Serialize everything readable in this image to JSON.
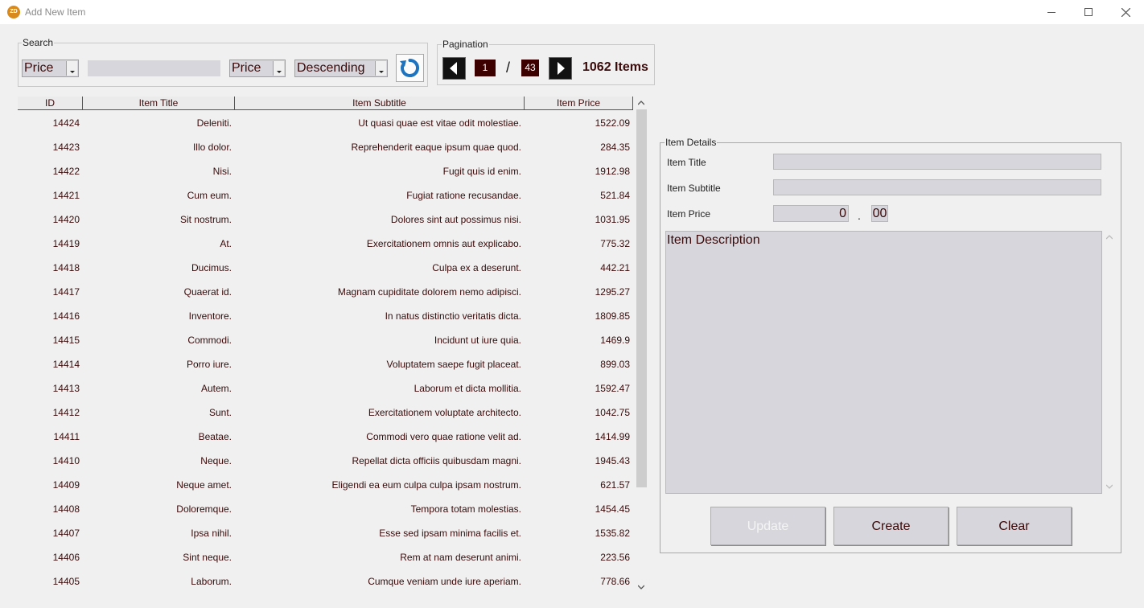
{
  "window": {
    "title": "Add New Item",
    "icon_text": "ZD"
  },
  "search": {
    "legend": "Search",
    "field_select": "Price",
    "query": "",
    "sort_by": "Price",
    "order": "Descending"
  },
  "pagination": {
    "legend": "Pagination",
    "current_page": "1",
    "separator": "/",
    "total_pages": "43",
    "items_count": "1062 Items"
  },
  "table": {
    "columns": [
      "ID",
      "Item Title",
      "Item Subtitle",
      "Item Price"
    ],
    "rows": [
      [
        "14424",
        "Deleniti.",
        "Ut quasi quae est vitae odit molestiae.",
        "1522.09"
      ],
      [
        "14423",
        "Illo dolor.",
        "Reprehenderit eaque ipsum quae quod.",
        "284.35"
      ],
      [
        "14422",
        "Nisi.",
        "Fugit quis id enim.",
        "1912.98"
      ],
      [
        "14421",
        "Cum eum.",
        "Fugiat ratione recusandae.",
        "521.84"
      ],
      [
        "14420",
        "Sit nostrum.",
        "Dolores sint aut possimus nisi.",
        "1031.95"
      ],
      [
        "14419",
        "At.",
        "Exercitationem omnis aut explicabo.",
        "775.32"
      ],
      [
        "14418",
        "Ducimus.",
        "Culpa ex a deserunt.",
        "442.21"
      ],
      [
        "14417",
        "Quaerat id.",
        "Magnam cupiditate dolorem nemo adipisci.",
        "1295.27"
      ],
      [
        "14416",
        "Inventore.",
        "In natus distinctio veritatis dicta.",
        "1809.85"
      ],
      [
        "14415",
        "Commodi.",
        "Incidunt ut iure quia.",
        "1469.9"
      ],
      [
        "14414",
        "Porro iure.",
        "Voluptatem saepe fugit placeat.",
        "899.03"
      ],
      [
        "14413",
        "Autem.",
        "Laborum et dicta mollitia.",
        "1592.47"
      ],
      [
        "14412",
        "Sunt.",
        "Exercitationem voluptate architecto.",
        "1042.75"
      ],
      [
        "14411",
        "Beatae.",
        "Commodi vero quae ratione velit ad.",
        "1414.99"
      ],
      [
        "14410",
        "Neque.",
        "Repellat dicta officiis quibusdam magni.",
        "1945.43"
      ],
      [
        "14409",
        "Neque amet.",
        "Eligendi ea eum culpa culpa ipsam nostrum.",
        "621.57"
      ],
      [
        "14408",
        "Doloremque.",
        "Tempora totam molestias.",
        "1454.45"
      ],
      [
        "14407",
        "Ipsa nihil.",
        "Esse sed ipsam minima facilis et.",
        "1535.82"
      ],
      [
        "14406",
        "Sint neque.",
        "Rem at nam deserunt animi.",
        "223.56"
      ],
      [
        "14405",
        "Laborum.",
        "Cumque veniam unde iure aperiam.",
        "778.66"
      ]
    ]
  },
  "details": {
    "legend": "Item Details",
    "title_label": "Item Title",
    "title_value": "",
    "subtitle_label": "Item Subtitle",
    "subtitle_value": "",
    "price_label": "Item Price",
    "price_int": "0",
    "price_sep": ".",
    "price_dec": "00",
    "description_placeholder": "Item Description"
  },
  "buttons": {
    "update": "Update",
    "create": "Create",
    "clear": "Clear"
  },
  "colors": {
    "accent_text": "#3a0a0a",
    "page_box": "#3d0000",
    "refresh_icon": "#1e73be"
  },
  "icons": {
    "refresh": "refresh-icon",
    "prev": "prev-page-icon",
    "next": "next-page-icon"
  }
}
